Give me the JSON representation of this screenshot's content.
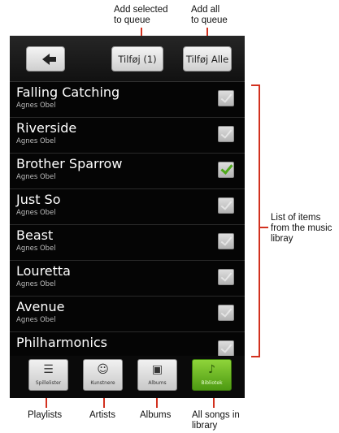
{
  "annotations": {
    "add_selected": [
      "Add selected",
      "to queue"
    ],
    "add_all": [
      "Add all",
      "to queue"
    ],
    "list_desc": [
      "List of items",
      "from the music",
      "libray"
    ],
    "playlists": "Playlists",
    "artists": "Artists",
    "albums": "Albums",
    "all_songs": [
      "All songs in",
      "library"
    ]
  },
  "toolbar": {
    "back_icon": "back-arrow-icon",
    "add_selected_label": "Tilføj (1)",
    "add_all_label": "Tilføj Alle"
  },
  "songs": [
    {
      "title": "Falling Catching",
      "artist": "Agnes Obel",
      "checked": false
    },
    {
      "title": "Riverside",
      "artist": "Agnes Obel",
      "checked": false
    },
    {
      "title": "Brother Sparrow",
      "artist": "Agnes Obel",
      "checked": true
    },
    {
      "title": "Just So",
      "artist": "Agnes Obel",
      "checked": false
    },
    {
      "title": "Beast",
      "artist": "Agnes Obel",
      "checked": false
    },
    {
      "title": "Louretta",
      "artist": "Agnes Obel",
      "checked": false
    },
    {
      "title": "Avenue",
      "artist": "Agnes Obel",
      "checked": false
    },
    {
      "title": "Philharmonics",
      "artist": "",
      "checked": false
    }
  ],
  "tabs": [
    {
      "label": "Spillelister",
      "icon": "list-icon",
      "active": false
    },
    {
      "label": "Kunstnere",
      "icon": "people-icon",
      "active": false
    },
    {
      "label": "Albums",
      "icon": "album-icon",
      "active": false
    },
    {
      "label": "Bibliotek",
      "icon": "music-note-icon",
      "active": true
    }
  ],
  "colors": {
    "annotation_line": "#d2311f",
    "active_tab": "#6db828",
    "check_mark": "#4ea81a"
  }
}
